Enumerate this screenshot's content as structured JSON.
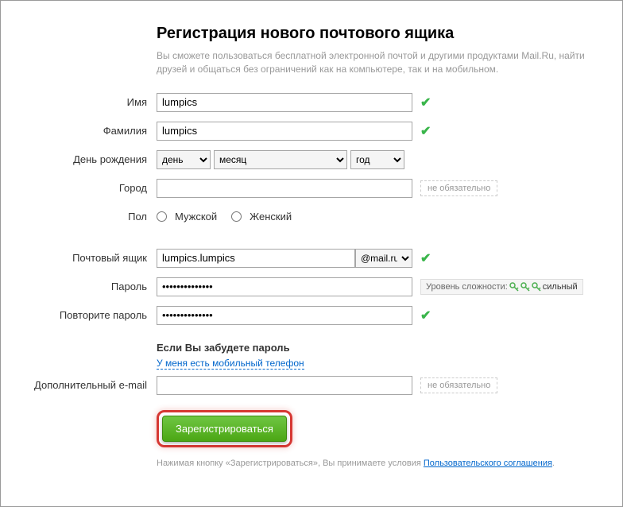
{
  "header": {
    "title": "Регистрация нового почтового ящика",
    "subtitle": "Вы сможете пользоваться бесплатной электронной почтой и другими продуктами Mail.Ru, найти друзей и общаться без ограничений как на компьютере, так и на мобильном."
  },
  "labels": {
    "firstname": "Имя",
    "lastname": "Фамилия",
    "birthday": "День рождения",
    "city": "Город",
    "gender": "Пол",
    "mailbox": "Почтовый ящик",
    "password": "Пароль",
    "password_repeat": "Повторите пароль",
    "additional_email": "Дополнительный e-mail"
  },
  "values": {
    "firstname": "lumpics",
    "lastname": "lumpics",
    "mailbox": "lumpics.lumpics",
    "password": "••••••••••••••",
    "password_repeat": "••••••••••••••"
  },
  "selects": {
    "day": "день",
    "month": "месяц",
    "year": "год",
    "domain": "@mail.ru"
  },
  "gender": {
    "male": "Мужской",
    "female": "Женский"
  },
  "optional_badge": "не обязательно",
  "strength": {
    "label": "Уровень сложности:",
    "value": "сильный"
  },
  "recovery": {
    "title": "Если Вы забудете пароль",
    "link": "У меня есть мобильный телефон"
  },
  "submit": "Зарегистрироваться",
  "footer": {
    "text": "Нажимая кнопку «Зарегистрироваться», Вы принимаете условия ",
    "link": "Пользовательского соглашения",
    "dot": "."
  }
}
